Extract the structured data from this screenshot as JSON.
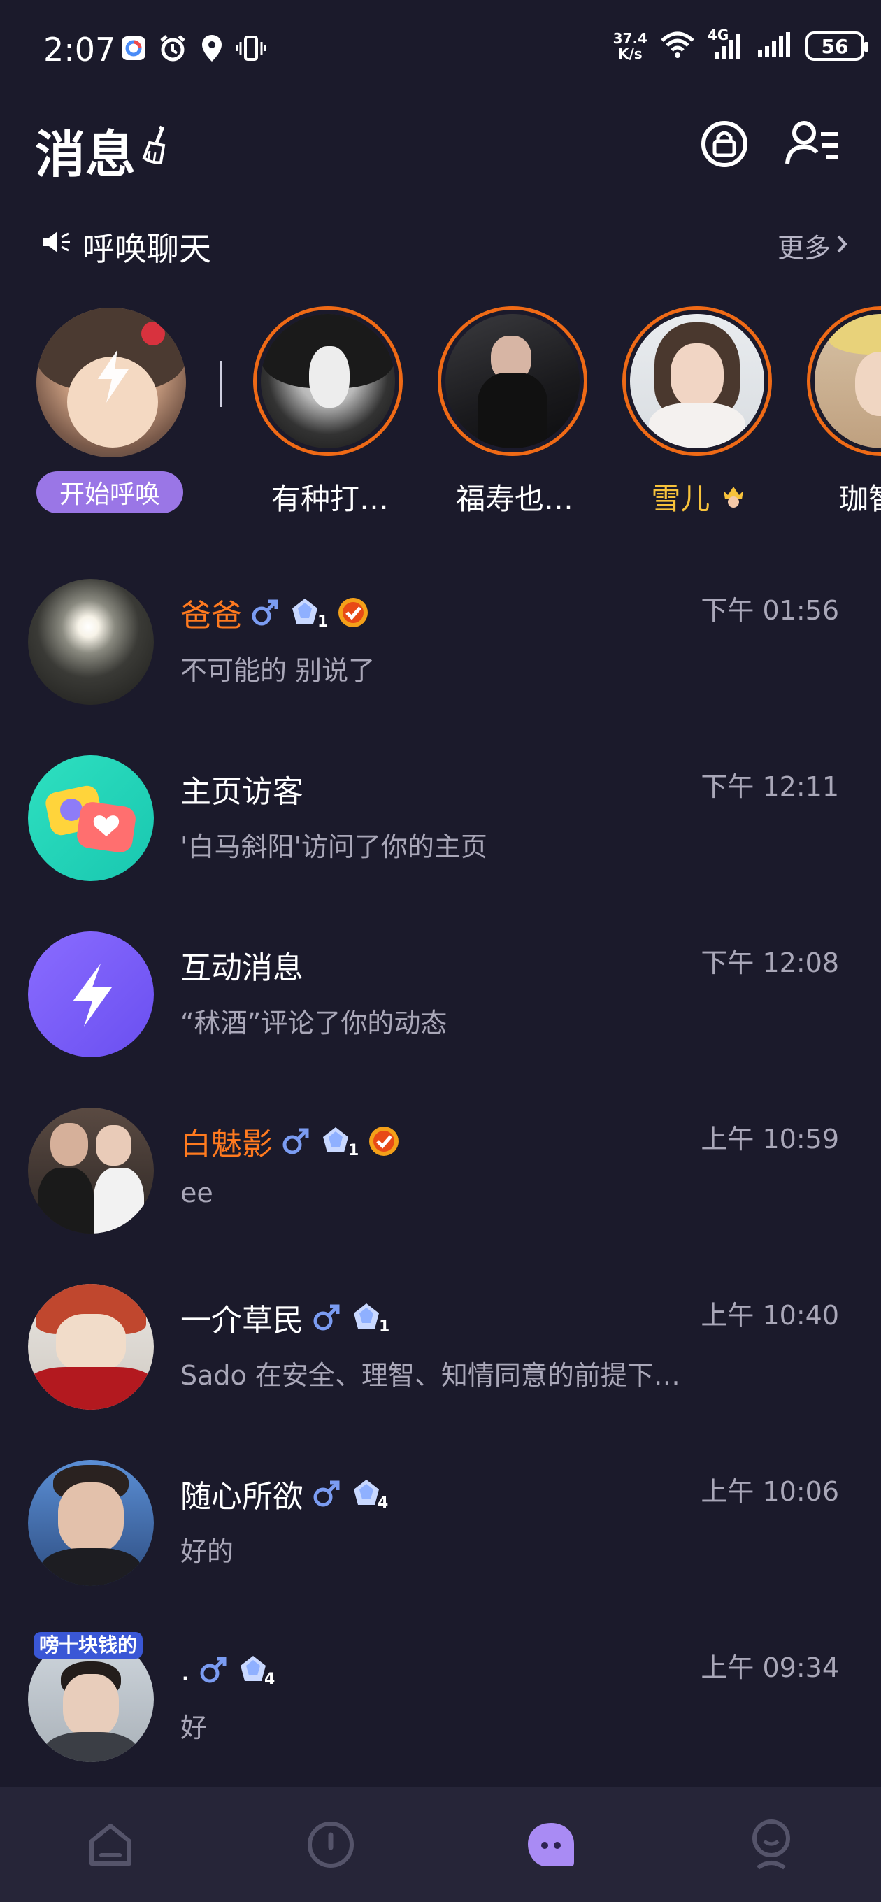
{
  "status_bar": {
    "time": "2:07",
    "speed_value": "37.4",
    "speed_unit": "K/s",
    "network": "4G",
    "battery": "56"
  },
  "header": {
    "title": "消息"
  },
  "call_section": {
    "title": "呼唤聊天",
    "more_label": "更多",
    "start_label": "开始呼唤",
    "stories": [
      {
        "name": "有种打…"
      },
      {
        "name": "福寿也…"
      },
      {
        "name": "雪儿"
      },
      {
        "name": "珈智"
      }
    ]
  },
  "conversations": [
    {
      "name": "爸爸",
      "time": "下午 01:56",
      "preview": "不可能的 别说了",
      "level": "1"
    },
    {
      "name": "主页访客",
      "time": "下午 12:11",
      "preview": "'白马斜阳'访问了你的主页"
    },
    {
      "name": "互动消息",
      "time": "下午 12:08",
      "preview": "“秫酒”评论了你的动态"
    },
    {
      "name": "白魅影",
      "time": "上午 10:59",
      "preview": "ee",
      "level": "1"
    },
    {
      "name": "一介草民",
      "time": "上午 10:40",
      "preview": "Sado 在安全、理智、知情同意的前提下…",
      "level": "1"
    },
    {
      "name": "随心所欲",
      "time": "上午 10:06",
      "preview": "好的",
      "level": "4"
    },
    {
      "name": ".",
      "time": "上午 09:34",
      "preview": "好",
      "level": "4",
      "avatar_tag": "嗙十块钱的"
    }
  ],
  "colors": {
    "background": "#1b1a2b",
    "accent_orange": "#ff7a1f",
    "accent_purple": "#9a76e6",
    "gold": "#f7c23b",
    "muted_text": "#a9a7b8",
    "nav_bg": "#262538"
  },
  "icons": {
    "status_left": [
      "app-icon",
      "alarm-icon",
      "location-icon",
      "vibrate-icon"
    ],
    "status_right": [
      "wifi-icon",
      "signal-icon",
      "signal-icon",
      "battery-icon"
    ],
    "header": [
      "broom-icon",
      "lock-icon",
      "contacts-icon"
    ],
    "nav": [
      "home-icon",
      "discover-icon",
      "messages-icon",
      "profile-icon"
    ]
  }
}
